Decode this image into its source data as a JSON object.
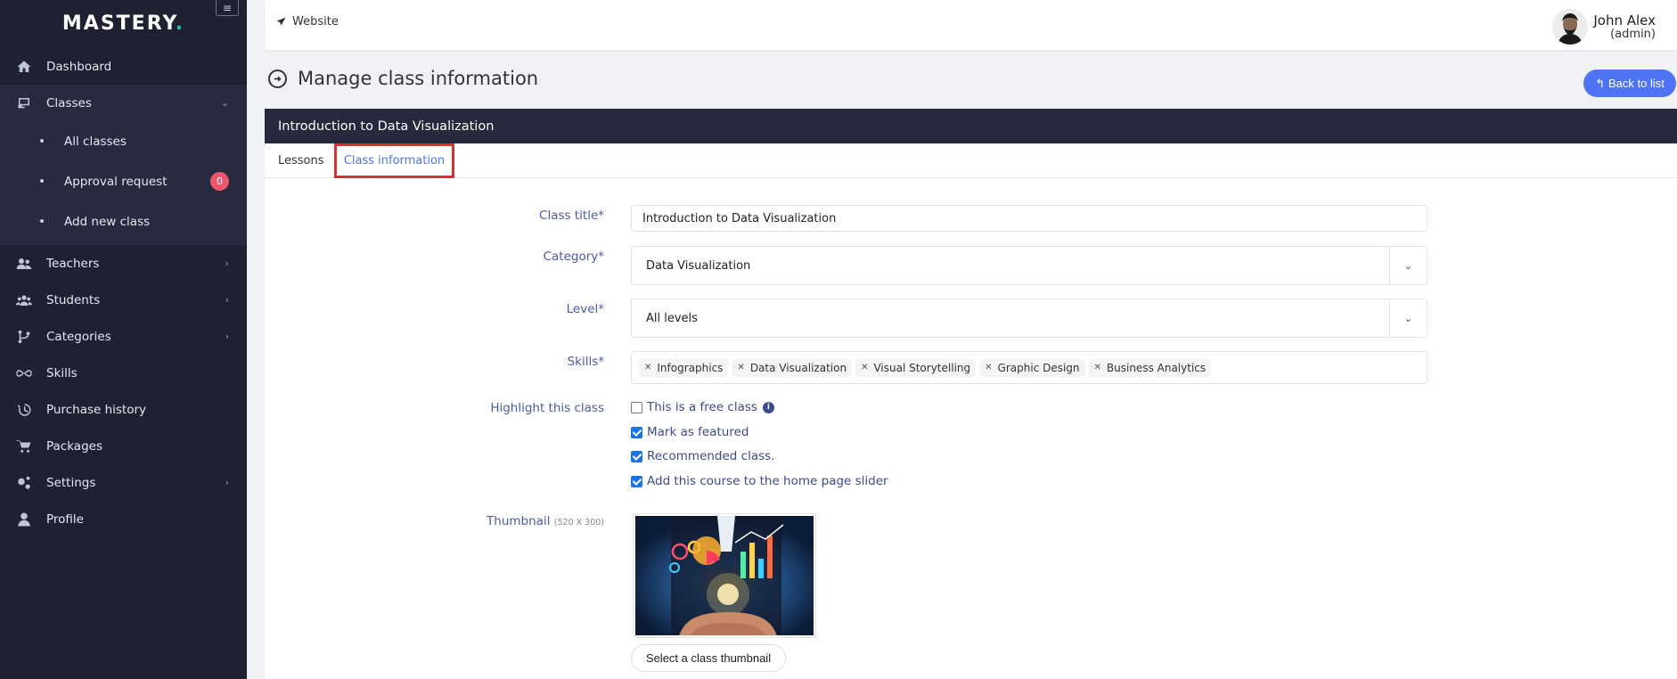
{
  "sidebar": {
    "logo": "MASTERY",
    "logo_dot": ".",
    "items": [
      {
        "label": "Dashboard",
        "icon": "home-icon"
      },
      {
        "label": "Classes",
        "icon": "classes-icon"
      },
      {
        "label": "Teachers",
        "icon": "teachers-icon"
      },
      {
        "label": "Students",
        "icon": "students-icon"
      },
      {
        "label": "Categories",
        "icon": "categories-icon"
      },
      {
        "label": "Skills",
        "icon": "skills-icon"
      },
      {
        "label": "Purchase history",
        "icon": "history-icon"
      },
      {
        "label": "Packages",
        "icon": "cart-icon"
      },
      {
        "label": "Settings",
        "icon": "gears-icon"
      },
      {
        "label": "Profile",
        "icon": "user-icon"
      }
    ],
    "sub_items": [
      {
        "label": "All classes"
      },
      {
        "label": "Approval request",
        "badge": "0"
      },
      {
        "label": "Add new class"
      }
    ]
  },
  "topbar": {
    "website_label": "Website",
    "user_name": "John Alex",
    "user_role": "(admin)"
  },
  "page": {
    "title": "Manage class information",
    "back_label": "Back to list"
  },
  "card": {
    "header": "Introduction to Data Visualization",
    "tabs": [
      {
        "label": "Lessons"
      },
      {
        "label": "Class information"
      }
    ]
  },
  "form": {
    "class_title_label": "Class title*",
    "class_title_value": "Introduction to Data Visualization",
    "category_label": "Category*",
    "category_value": "Data Visualization",
    "level_label": "Level*",
    "level_value": "All levels",
    "skills_label": "Skills*",
    "skills": [
      "Infographics",
      "Data Visualization",
      "Visual Storytelling",
      "Graphic Design",
      "Business Analytics"
    ],
    "highlight_label": "Highlight this class",
    "checks": [
      {
        "label": "This is a free class",
        "checked": false
      },
      {
        "label": "Mark as featured",
        "checked": true
      },
      {
        "label": "Recommended class.",
        "checked": true
      },
      {
        "label": "Add this course to the home page slider",
        "checked": true
      }
    ],
    "thumbnail_label": "Thumbnail",
    "thumbnail_size": "(520 X 300)",
    "thumbnail_button": "Select a class thumbnail"
  },
  "colors": {
    "sidebar_bg": "#1f2132",
    "accent": "#4e73f5",
    "badge": "#f1556c",
    "tab_highlight_border": "#e52b2b"
  }
}
